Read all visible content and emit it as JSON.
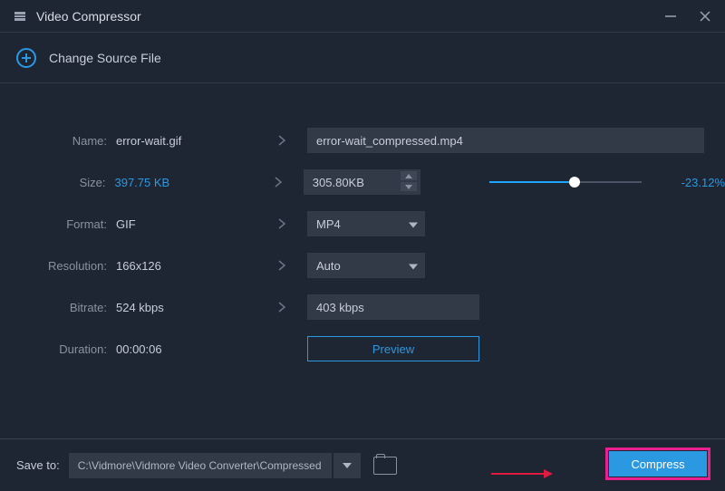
{
  "window": {
    "title": "Video Compressor"
  },
  "header": {
    "change_source_label": "Change Source File"
  },
  "labels": {
    "name": "Name:",
    "size": "Size:",
    "format": "Format:",
    "resolution": "Resolution:",
    "bitrate": "Bitrate:",
    "duration": "Duration:"
  },
  "source": {
    "name": "error-wait.gif",
    "size": "397.75 KB",
    "format": "GIF",
    "resolution": "166x126",
    "bitrate": "524 kbps",
    "duration": "00:00:06"
  },
  "output": {
    "name": "error-wait_compressed.mp4",
    "size": "305.80KB",
    "format": "MP4",
    "resolution": "Auto",
    "bitrate": "403 kbps"
  },
  "slider": {
    "percent_label": "-23.12%",
    "fill_percent": 56
  },
  "buttons": {
    "preview": "Preview",
    "compress": "Compress"
  },
  "bottom": {
    "save_to_label": "Save to:",
    "path": "C:\\Vidmore\\Vidmore Video Converter\\Compressed"
  }
}
